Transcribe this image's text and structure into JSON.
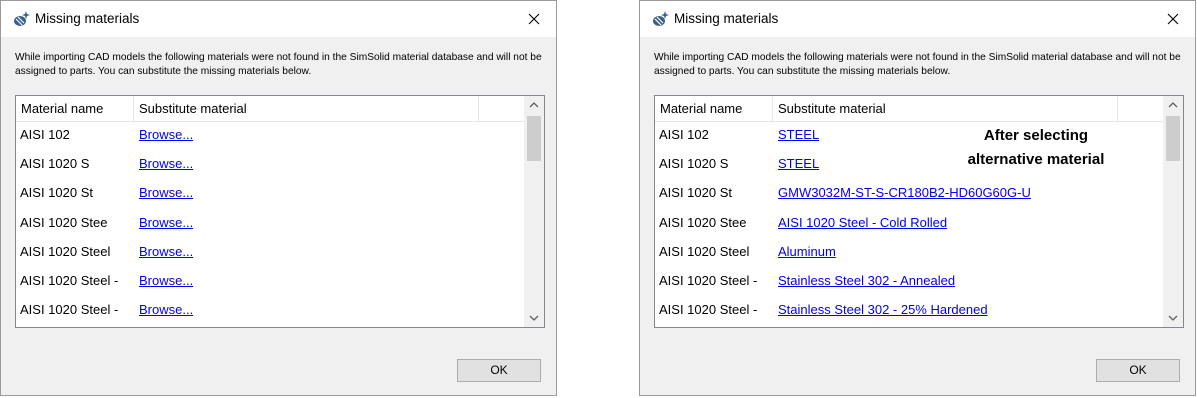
{
  "dialogs": [
    {
      "title": "Missing materials",
      "message": "While importing CAD models the following materials were not found in the SimSolid material database and will not be assigned to parts. You can substitute the missing materials below.",
      "columns": {
        "name": "Material name",
        "substitute": "Substitute material"
      },
      "rows": [
        {
          "name": "AISI 102",
          "substitute": "Browse..."
        },
        {
          "name": "AISI 1020 S",
          "substitute": "Browse..."
        },
        {
          "name": "AISI 1020 St",
          "substitute": "Browse..."
        },
        {
          "name": "AISI 1020 Stee",
          "substitute": "Browse..."
        },
        {
          "name": "AISI 1020 Steel",
          "substitute": "Browse..."
        },
        {
          "name": "AISI 1020 Steel -",
          "substitute": "Browse..."
        },
        {
          "name": "AISI 1020 Steel -",
          "substitute": "Browse..."
        }
      ],
      "ok_label": "OK"
    },
    {
      "title": "Missing materials",
      "message": "While importing CAD models the following materials were not found in the SimSolid material database and will not be assigned to parts. You can substitute the missing materials below.",
      "columns": {
        "name": "Material name",
        "substitute": "Substitute material"
      },
      "rows": [
        {
          "name": "AISI 102",
          "substitute": "STEEL"
        },
        {
          "name": "AISI 1020 S",
          "substitute": "STEEL"
        },
        {
          "name": "AISI 1020 St",
          "substitute": "GMW3032M-ST-S-CR180B2-HD60G60G-U"
        },
        {
          "name": "AISI 1020 Stee",
          "substitute": "AISI 1020 Steel - Cold Rolled"
        },
        {
          "name": "AISI 1020 Steel",
          "substitute": "Aluminum"
        },
        {
          "name": "AISI 1020 Steel -",
          "substitute": "Stainless Steel 302 - Annealed"
        },
        {
          "name": "AISI 1020 Steel -",
          "substitute": "Stainless Steel 302 - 25% Hardened"
        }
      ],
      "ok_label": "OK"
    }
  ],
  "annotation": {
    "line1": "After selecting",
    "line2": "alternative  material"
  },
  "icons": {
    "app": "simsolid-app-icon",
    "close": "close-icon",
    "scroll_up": "scroll-up-arrow-icon",
    "scroll_down": "scroll-down-arrow-icon"
  },
  "colors": {
    "link": "#0000ee",
    "dialog_bg": "#f0f0f0",
    "title_bg": "#ffffff"
  }
}
